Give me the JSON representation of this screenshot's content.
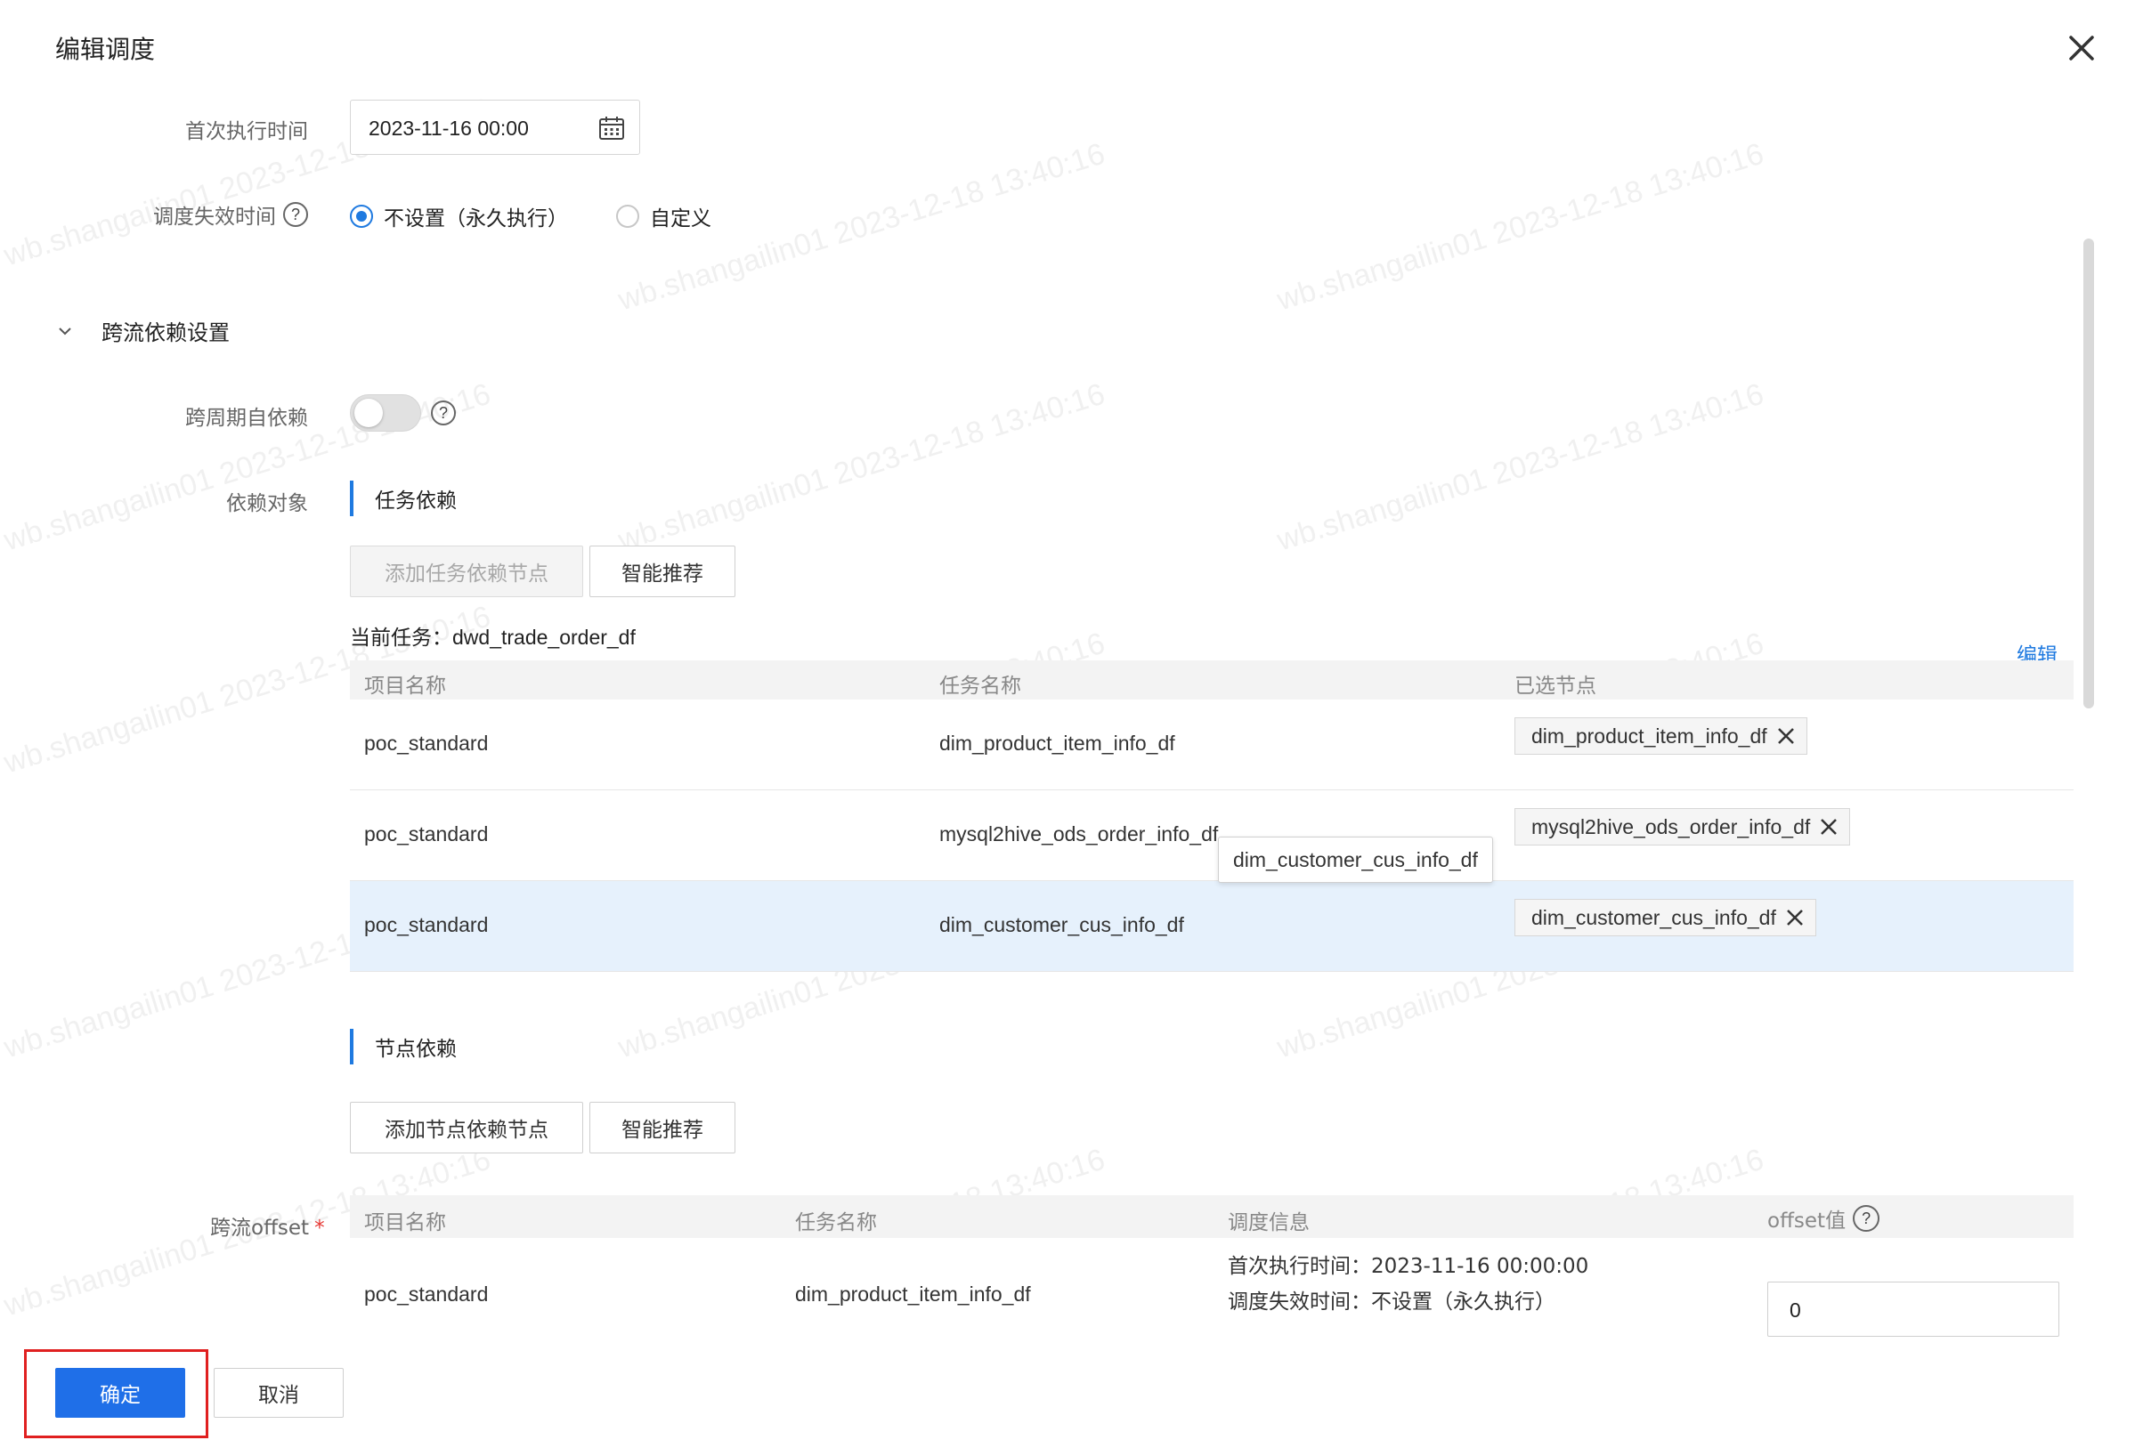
{
  "dialog": {
    "title": "编辑调度"
  },
  "schedule": {
    "first_exec_label": "首次执行时间",
    "first_exec_value": "2023-11-16 00:00",
    "expire_label": "调度失效时间",
    "expire_options": [
      "不设置（永久执行）",
      "自定义"
    ],
    "expire_selected": "不设置（永久执行）"
  },
  "cross_dep": {
    "section_title": "跨流依赖设置",
    "self_dep_label": "跨周期自依赖",
    "self_dep_on": false,
    "dep_target_label": "依赖对象",
    "task_dep": {
      "title": "任务依赖",
      "add_button": "添加任务依赖节点",
      "recommend_button": "智能推荐",
      "current_task_label": "当前任务：",
      "current_task_value": "dwd_trade_order_df",
      "edit_link": "编辑",
      "columns": [
        "项目名称",
        "任务名称",
        "已选节点"
      ],
      "rows": [
        {
          "project": "poc_standard",
          "task": "dim_product_item_info_df",
          "node": "dim_product_item_info_df"
        },
        {
          "project": "poc_standard",
          "task": "mysql2hive_ods_order_info_df",
          "node": "mysql2hive_ods_order_info_df"
        },
        {
          "project": "poc_standard",
          "task": "dim_customer_cus_info_df",
          "node": "dim_customer_cus_info_df"
        }
      ],
      "tooltip": "dim_customer_cus_info_df"
    },
    "node_dep": {
      "title": "节点依赖",
      "add_button": "添加节点依赖节点",
      "recommend_button": "智能推荐",
      "offset_label": "跨流offset",
      "required_mark": "*",
      "columns": [
        "项目名称",
        "任务名称",
        "调度信息",
        "offset值"
      ],
      "rows": [
        {
          "project": "poc_standard",
          "task": "dim_product_item_info_df",
          "info_first": "首次执行时间：2023-11-16 00:00:00",
          "info_expire": "调度失效时间：不设置（永久执行）",
          "offset": "0"
        }
      ]
    }
  },
  "footer": {
    "confirm": "确定",
    "cancel": "取消"
  },
  "watermark_text": "wb.shangailin01 2023-12-18 13:40:16",
  "colors": {
    "accent": "#1f7ae0",
    "primary_button": "#1f6fe8",
    "highlight_row": "#e6f1fc",
    "callout": "#e02020"
  }
}
